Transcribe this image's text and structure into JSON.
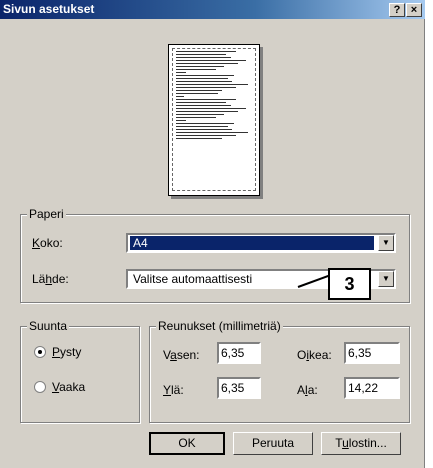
{
  "dialog": {
    "title": "Sivun asetukset",
    "help_button": "?",
    "close_button": "×"
  },
  "paper_group": {
    "title": "Paperi",
    "size_label": "Koko:",
    "size_value": "A4",
    "source_label": "Lähde:",
    "source_value": "Valitse automaattisesti"
  },
  "orientation_group": {
    "title": "Suunta",
    "portrait": "Pysty",
    "landscape": "Vaaka",
    "selected": "Pysty"
  },
  "margins_group": {
    "title": "Reunukset (millimetriä)",
    "left_label": "Vasen:",
    "left_value": "6,35",
    "right_label": "Oikea:",
    "right_value": "6,35",
    "top_label": "Ylä:",
    "top_value": "6,35",
    "bottom_label": "Ala:",
    "bottom_value": "14,22"
  },
  "buttons": {
    "ok": "OK",
    "cancel": "Peruuta",
    "printer": "Tulostin..."
  },
  "annotation": {
    "callout": "3"
  }
}
